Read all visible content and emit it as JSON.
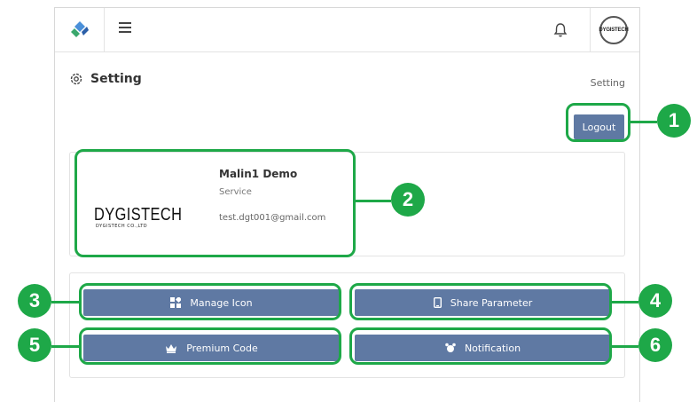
{
  "header": {
    "avatar_text": "DYGISTECH"
  },
  "page": {
    "title": "Setting",
    "breadcrumb": "Setting"
  },
  "actions": {
    "logout_label": "Logout"
  },
  "profile": {
    "brand_main": "DYGISTECH",
    "brand_sub": "DYGISTECH CO.,LTD",
    "name": "Malin1 Demo",
    "role": "Service",
    "email": "test.dgt001@gmail.com"
  },
  "buttons": {
    "manage_icon": "Manage Icon",
    "share_parameter": "Share Parameter",
    "premium_code": "Premium Code",
    "notification": "Notification"
  },
  "annotations": [
    "1",
    "2",
    "3",
    "4",
    "5",
    "6"
  ],
  "colors": {
    "primary_button": "#5f79a3",
    "highlight": "#1ea848"
  },
  "icons": [
    "app-logo-icon",
    "menu-icon",
    "bell-icon",
    "settings-gear-icon",
    "widgets-icon",
    "phone-icon",
    "crown-icon",
    "alarm-icon"
  ]
}
